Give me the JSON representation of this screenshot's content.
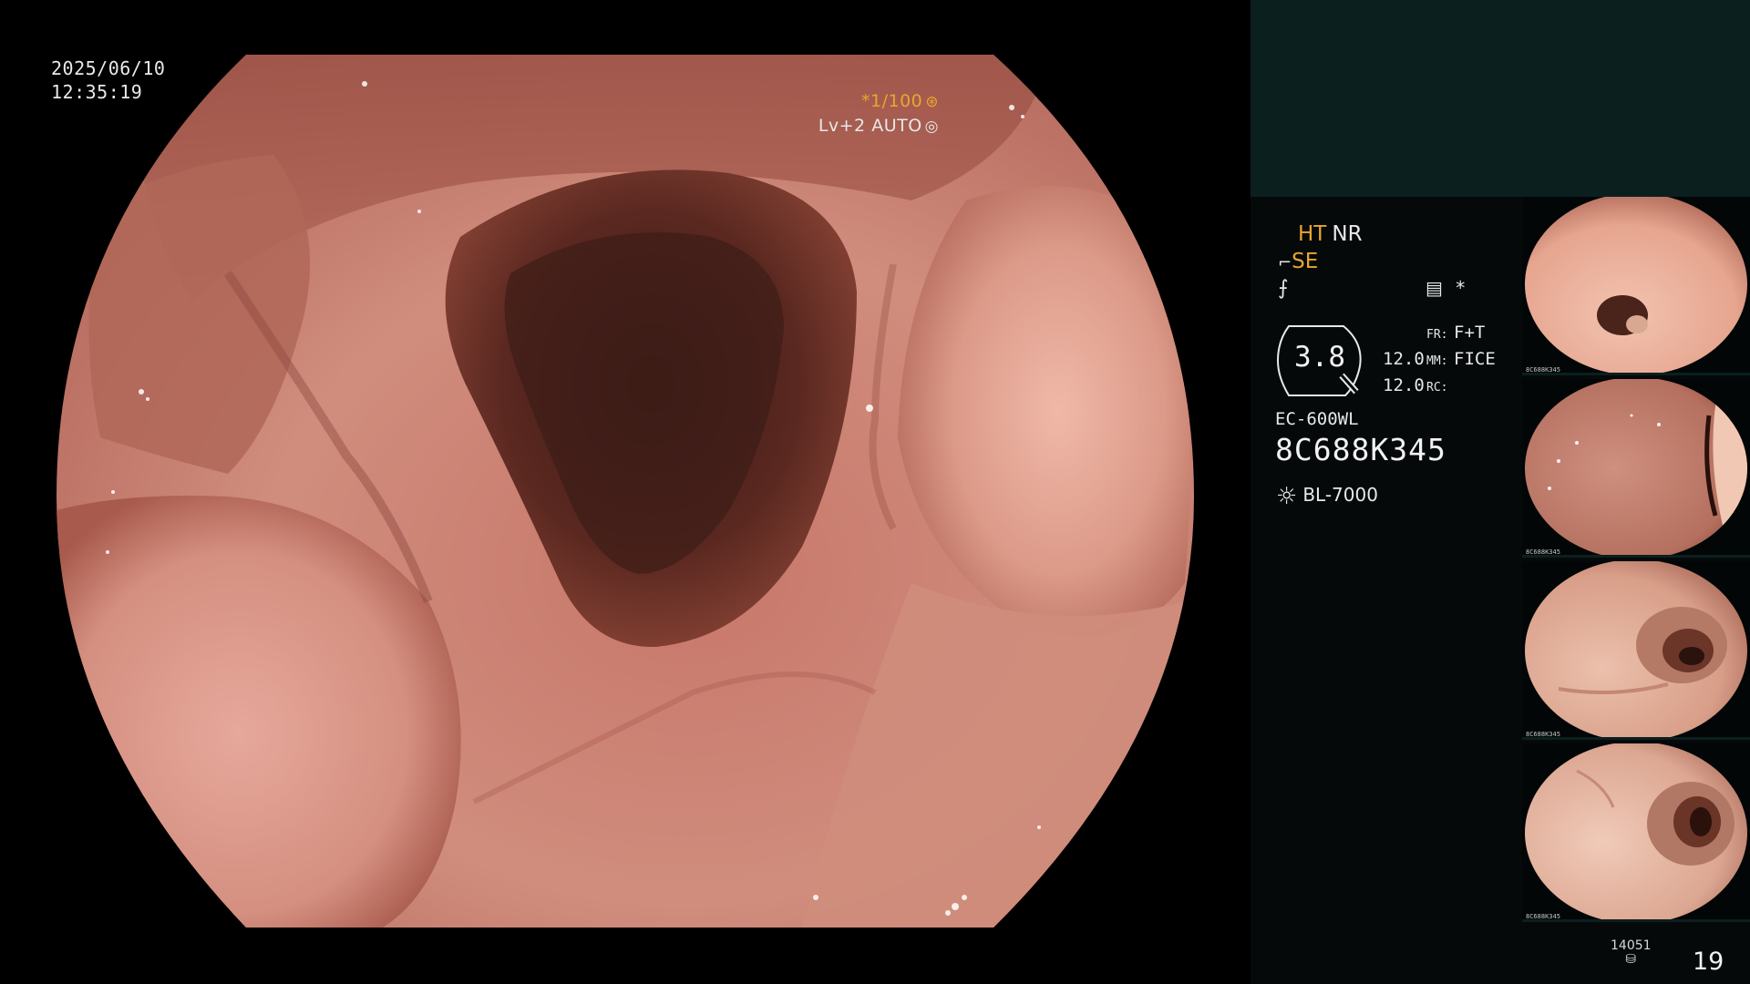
{
  "osd": {
    "date": "2025/06/10",
    "time": "12:35:19",
    "shutter": "*1/100",
    "shutter_icon": "aperture-icon",
    "iris": "Lv+2 AUTO",
    "iris_icon": "iris-ring-icon"
  },
  "panel": {
    "mode_ht": "HT",
    "mode_nr": "NR",
    "se_label": "SE",
    "se_icon": "structure-enhance-icon",
    "pencil_icon": "freeze-icon",
    "menu_icon": "settings-list-icon",
    "asterisk": "*",
    "zoom_value": "3.8",
    "params": [
      {
        "left": "",
        "key": "FR:",
        "value": "F+T"
      },
      {
        "left": "12.0",
        "key": "MM:",
        "value": "FICE"
      },
      {
        "left": "12.0",
        "key": "RC:",
        "value": ""
      }
    ],
    "scope_model": "EC-600WL",
    "scope_serial": "8C688K345",
    "light_source": "BL-7000",
    "light_icon": "lamp-icon",
    "counter": "14051",
    "counter_icon": "storage-icon",
    "frame_count": "19"
  },
  "thumbnails": [
    {
      "caption": "8C688K345",
      "name": "thumbnail-1"
    },
    {
      "caption": "8C688K345",
      "name": "thumbnail-2"
    },
    {
      "caption": "8C688K345",
      "name": "thumbnail-3"
    },
    {
      "caption": "8C688K345",
      "name": "thumbnail-4"
    }
  ],
  "colors": {
    "accent_orange": "#e8a530",
    "panel_top": "#0b1f1f",
    "panel_bg": "#050909",
    "mucosa": "#c98b7a"
  }
}
